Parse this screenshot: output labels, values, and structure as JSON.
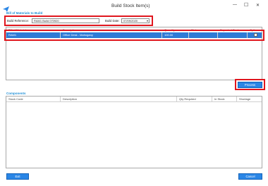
{
  "window": {
    "title": "Build Stock Item(s)",
    "minimize_glyph": "—",
    "maximize_glyph": "☐",
    "close_glyph": "✕",
    "logo_icon": "paper-plane-icon"
  },
  "bom": {
    "section_title": "Bill of Materials to Build",
    "build_reference_label": "Build Reference:",
    "build_reference_value": "RAM1 Build 070920",
    "build_date_label": "Build Date:",
    "build_date_value": "07/09/2020",
    "columns": [
      "Bill of Materials",
      "Description",
      "Quantity",
      "Status",
      "Expected Cost",
      "Option"
    ],
    "row": {
      "bom": "RAM1",
      "description": "Office Desk - Mahogany",
      "quantity": "100.00",
      "status": "",
      "expected_cost": ""
    }
  },
  "process_button": "Process",
  "components": {
    "section_title": "Components",
    "columns": [
      "Stock Code",
      "Description",
      "Qty Required",
      "In Stock",
      "Shortage"
    ]
  },
  "footer": {
    "exit_button": "Exit",
    "cancel_button": "Cancel"
  },
  "colors": {
    "accent": "#1f8fd6",
    "highlight": "#e0161e",
    "selection": "#2f7bd6",
    "button": "#2a86e6"
  }
}
